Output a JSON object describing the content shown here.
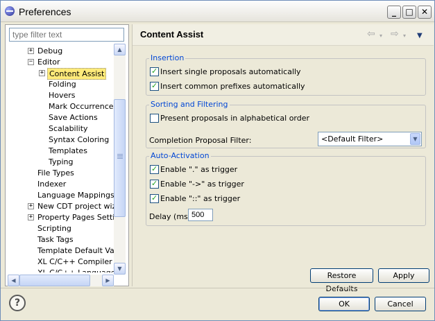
{
  "window": {
    "title": "Preferences"
  },
  "titlebar": {
    "min_glyph": "_",
    "max_glyph": "□",
    "close_glyph": "✕"
  },
  "left": {
    "filter_placeholder": "type filter text",
    "tree": [
      {
        "label": "Debug",
        "indent": 1,
        "expander": "+"
      },
      {
        "label": "Editor",
        "indent": 1,
        "expander": "−"
      },
      {
        "label": "Content Assist",
        "indent": 2,
        "expander": "+",
        "selected": true
      },
      {
        "label": "Folding",
        "indent": 2
      },
      {
        "label": "Hovers",
        "indent": 2
      },
      {
        "label": "Mark Occurrences",
        "indent": 2
      },
      {
        "label": "Save Actions",
        "indent": 2
      },
      {
        "label": "Scalability",
        "indent": 2
      },
      {
        "label": "Syntax Coloring",
        "indent": 2
      },
      {
        "label": "Templates",
        "indent": 2
      },
      {
        "label": "Typing",
        "indent": 2
      },
      {
        "label": "File Types",
        "indent": 1
      },
      {
        "label": "Indexer",
        "indent": 1
      },
      {
        "label": "Language Mappings",
        "indent": 1
      },
      {
        "label": "New CDT project wizard",
        "indent": 1,
        "expander": "+"
      },
      {
        "label": "Property Pages Settings",
        "indent": 1,
        "expander": "+"
      },
      {
        "label": "Scripting",
        "indent": 1
      },
      {
        "label": "Task Tags",
        "indent": 1
      },
      {
        "label": "Template Default Values",
        "indent": 1
      },
      {
        "label": "XL C/C++ Compiler",
        "indent": 1
      },
      {
        "label": "XL C/C++ Language Options",
        "indent": 1
      }
    ],
    "scroll_up": "▲",
    "scroll_down": "▼",
    "scroll_left": "◀",
    "scroll_right": "▶"
  },
  "page": {
    "title": "Content Assist",
    "nav": {
      "back": "⇦",
      "forward": "⇨",
      "dropdown": "▾",
      "menu": "▼"
    },
    "insertion": {
      "title": "Insertion",
      "options": [
        {
          "label": "Insert single proposals automatically",
          "checked": true
        },
        {
          "label": "Insert common prefixes automatically",
          "checked": true
        }
      ]
    },
    "sorting": {
      "title": "Sorting and Filtering",
      "option": {
        "label": "Present proposals in alphabetical order",
        "checked": false
      },
      "filter_label": "Completion Proposal Filter:",
      "filter_value": "<Default Filter>"
    },
    "auto_activation": {
      "title": "Auto-Activation",
      "options": [
        {
          "label": "Enable \".\" as trigger",
          "checked": true
        },
        {
          "label": "Enable \"->\" as trigger",
          "checked": true
        },
        {
          "label": "Enable \"::\" as trigger",
          "checked": true
        }
      ],
      "delay_label": "Delay (ms)",
      "delay_value": "500"
    },
    "restore_defaults": "Restore Defaults",
    "apply": "Apply"
  },
  "footer": {
    "help": "?",
    "ok": "OK",
    "cancel": "Cancel"
  },
  "check_glyph": "✓"
}
